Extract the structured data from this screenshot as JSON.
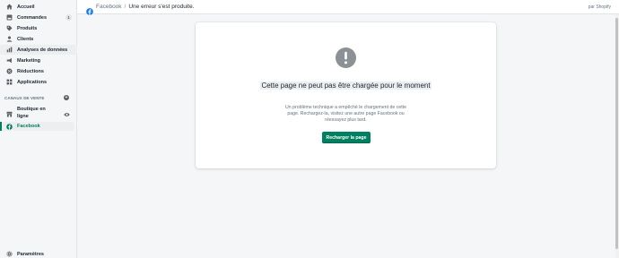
{
  "sidebar": {
    "items": [
      {
        "label": "Accueil",
        "icon": "home-icon"
      },
      {
        "label": "Commandes",
        "icon": "orders-icon",
        "badge": "1"
      },
      {
        "label": "Produits",
        "icon": "tag-icon"
      },
      {
        "label": "Clients",
        "icon": "person-icon"
      },
      {
        "label": "Analyses de données",
        "icon": "analytics-icon"
      },
      {
        "label": "Marketing",
        "icon": "marketing-icon"
      },
      {
        "label": "Réductions",
        "icon": "discount-icon"
      },
      {
        "label": "Applications",
        "icon": "apps-icon"
      }
    ],
    "channels_title": "CANAUX DE VENTE",
    "online_store": "Boutique en ligne",
    "facebook": "Facebook",
    "settings": "Paramètres"
  },
  "topbar": {
    "breadcrumb": "Facebook",
    "separator": "/",
    "title": "Une erreur s'est produite.",
    "by": "par Shopify"
  },
  "error": {
    "title": "Cette page ne peut pas être chargée pour le moment",
    "description": "Un problème technique a empêché le chargement de cette page. Rechargez-la, visitez une autre page Facebook ou réessayez plus tard.",
    "button": "Recharger la page"
  },
  "colors": {
    "primary": "#008060",
    "active_text": "#007f5f",
    "facebook_blue": "#1877f2",
    "icon_grey": "#5c5f62"
  }
}
